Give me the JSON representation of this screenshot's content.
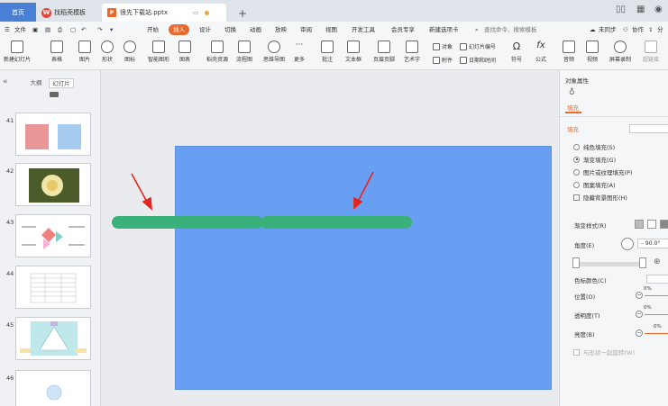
{
  "titlebar": {
    "home_tab": "首页",
    "wps_tab": "找稻壳模板",
    "wps_logo": "W",
    "file_tab": "很先下载站.pptx",
    "file_logo": "P",
    "add_tab": "+"
  },
  "menu": {
    "file": "文件",
    "start": "开始",
    "insert": "插入",
    "design": "设计",
    "switch": "切换",
    "animation": "动画",
    "slideshow": "放映",
    "review": "审阅",
    "view": "视图",
    "devtools": "开发工具",
    "member": "会员专享",
    "newtab": "新建选项卡",
    "search": "查找命令、搜索模板",
    "sync": "未同步",
    "collab": "协作",
    "share": "分享"
  },
  "toolbar": {
    "new_slide": "新建幻灯片",
    "table": "表格",
    "picture": "图片",
    "shape": "形状",
    "icon": "图标",
    "smartart": "智能图形",
    "chart": "图表",
    "online_flowchart": "稻壳资源",
    "flowchart": "流程图",
    "mindmap": "思维导图",
    "more": "更多",
    "comment": "批注",
    "textbox": "文本框",
    "header_footer": "页眉页脚",
    "wordart": "艺术字",
    "object": "对象",
    "slide_number": "幻灯片编号",
    "attachment": "附件",
    "datetime": "日期和时间",
    "symbol": "符号",
    "formula": "公式",
    "audio": "音频",
    "video": "视频",
    "screenrecord": "屏幕录制",
    "hyperlink": "超链接"
  },
  "left_panel": {
    "collapse": "«",
    "tab_outline": "大纲",
    "tab_slides": "幻灯片",
    "thumbs": [
      {
        "num": "41"
      },
      {
        "num": "42"
      },
      {
        "num": "43"
      },
      {
        "num": "44"
      },
      {
        "num": "45"
      },
      {
        "num": "46"
      }
    ]
  },
  "right_panel": {
    "title": "对象属性",
    "tab_fill": "填充",
    "section_fill": "填充",
    "options": {
      "solid": "纯色填充(S)",
      "gradient": "渐变填充(G)",
      "picture": "图片或纹理填充(P)",
      "pattern": "图案填充(A)",
      "hide_bg": "隐藏背景图形(H)"
    },
    "gradient_style": "渐变样式(R)",
    "angle": "角度(E)",
    "angle_value": "90.0°",
    "color": "色标颜色(C)",
    "position": "位置(O)",
    "transparency": "透明度(T)",
    "brightness": "亮度(B)",
    "pct1": "0%",
    "pct2": "0%",
    "pct3": "0%",
    "rotate_with_shape": "与形状一起旋转(W)"
  },
  "colors": {
    "accent": "#e96a2e",
    "slide_bg": "#689ff2",
    "bar": "#3ab07b",
    "arrow": "#e8231b"
  }
}
